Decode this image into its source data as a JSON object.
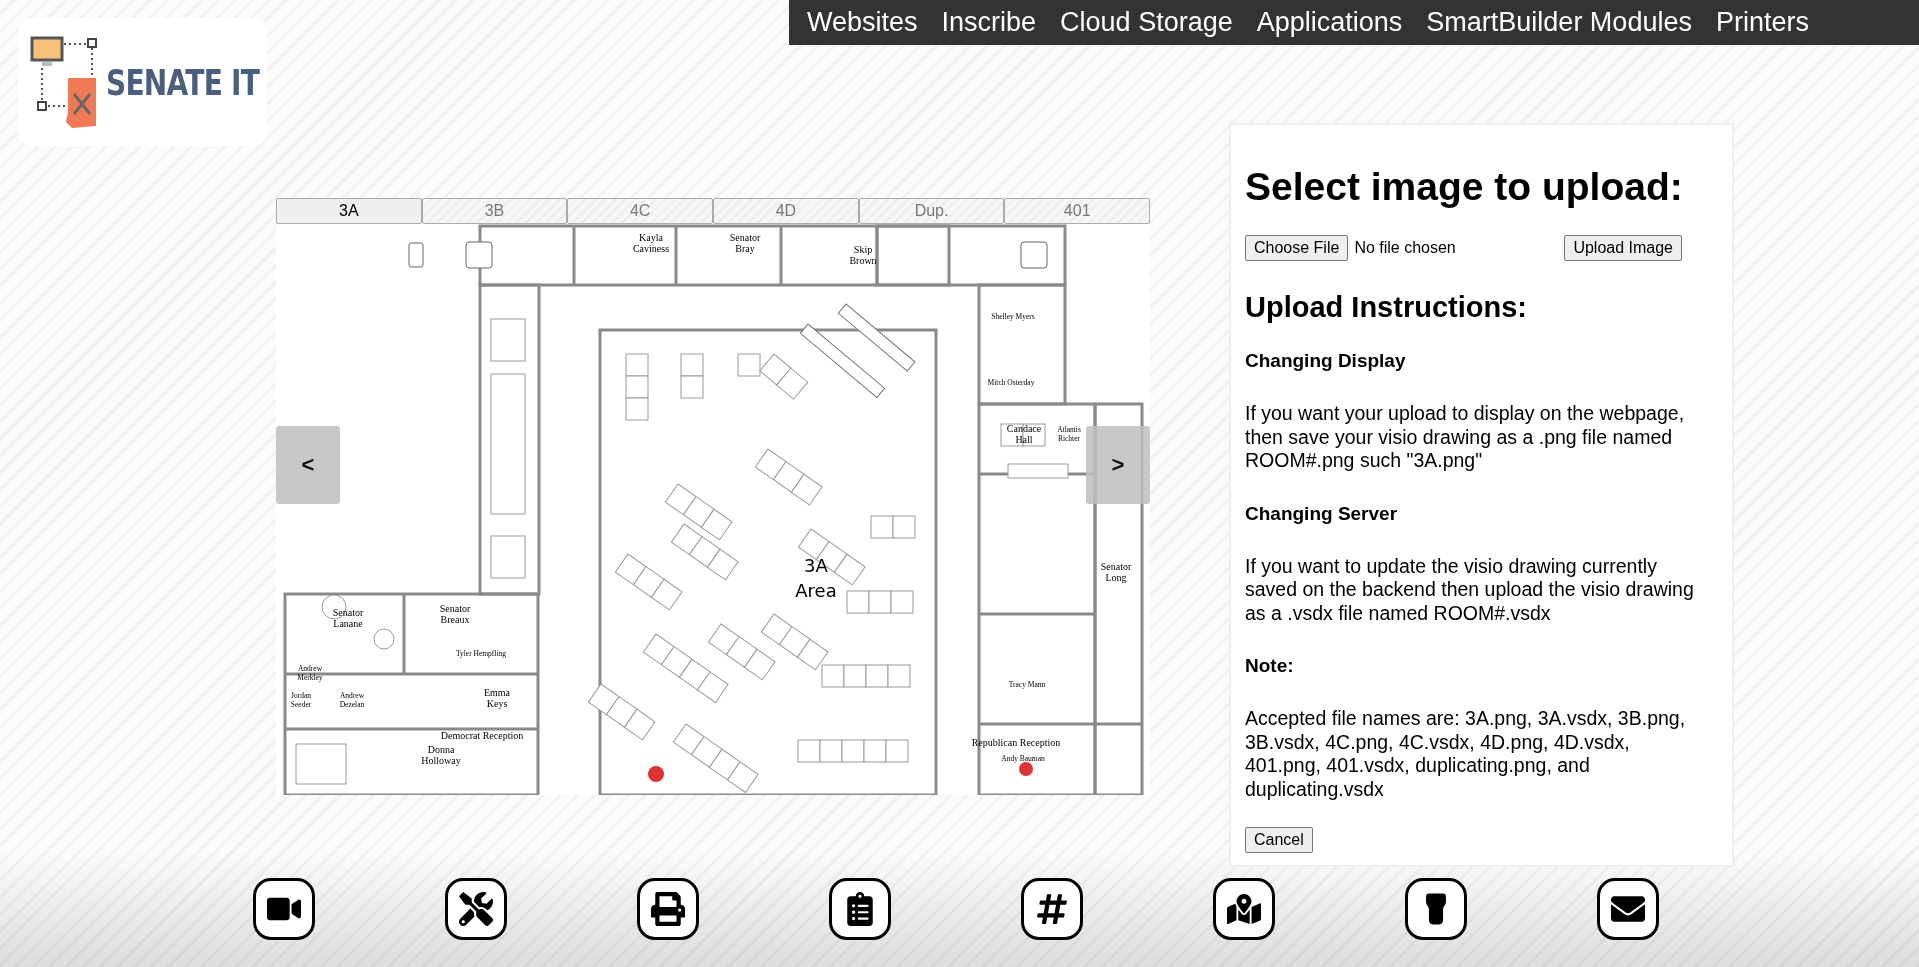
{
  "logo": {
    "text": "SENATE IT"
  },
  "nav": [
    {
      "label": "Websites"
    },
    {
      "label": "Inscribe"
    },
    {
      "label": "Cloud Storage"
    },
    {
      "label": "Applications"
    },
    {
      "label": "SmartBuilder Modules"
    },
    {
      "label": "Printers"
    }
  ],
  "floor_tabs": [
    {
      "label": "3A",
      "selected": true
    },
    {
      "label": "3B",
      "selected": false
    },
    {
      "label": "4C",
      "selected": false
    },
    {
      "label": "4D",
      "selected": false
    },
    {
      "label": "Dup.",
      "selected": false
    },
    {
      "label": "401",
      "selected": false
    }
  ],
  "floor_plan": {
    "prev": "<",
    "next": ">",
    "area_label": [
      "3A",
      "Area"
    ],
    "labels": [
      {
        "lines": [
          "Kayla",
          "Caviness"
        ]
      },
      {
        "lines": [
          "Senator",
          "Bray"
        ]
      },
      {
        "lines": [
          "Skip",
          "Brown"
        ]
      },
      {
        "lines": [
          "Shelley Myers"
        ]
      },
      {
        "lines": [
          "Mitch Osterday"
        ]
      },
      {
        "lines": [
          "Candace",
          "Hall"
        ]
      },
      {
        "lines": [
          "Atlantis",
          "Richter"
        ]
      },
      {
        "lines": [
          "Senator",
          "Long"
        ]
      },
      {
        "lines": [
          "Senator",
          "Lanane"
        ]
      },
      {
        "lines": [
          "Senator",
          "Breaux"
        ]
      },
      {
        "lines": [
          "Tyler Hempfling"
        ]
      },
      {
        "lines": [
          "Andrew",
          "Merkley"
        ]
      },
      {
        "lines": [
          "Jordan",
          "Seeder"
        ]
      },
      {
        "lines": [
          "Andrew",
          "Dezelan"
        ]
      },
      {
        "lines": [
          "Emma",
          "Keys"
        ]
      },
      {
        "lines": [
          "Democrat Reception"
        ]
      },
      {
        "lines": [
          "Donna",
          "Holloway"
        ]
      },
      {
        "lines": [
          "Tracy Mann"
        ]
      },
      {
        "lines": [
          "Republican Reception"
        ]
      },
      {
        "lines": [
          "Andy Bauman"
        ]
      }
    ]
  },
  "upload": {
    "title": "Select image to upload:",
    "choose_button": "Choose File",
    "file_status": "No file chosen",
    "upload_button": "Upload Image",
    "instructions_title": "Upload Instructions:",
    "sections": [
      {
        "heading": "Changing Display",
        "body": "If you want your upload to display on the webpage, then save your visio drawing as a .png file named ROOM#.png such \"3A.png\""
      },
      {
        "heading": "Changing Server",
        "body": "If you want to update the visio drawing currently saved on the backend then upload the visio drawing as a .vsdx file named ROOM#.vsdx"
      },
      {
        "heading": "Note:",
        "body": "Accepted file names are: 3A.png, 3A.vsdx, 3B.png, 3B.vsdx, 4C.png, 4C.vsdx, 4D.png, 4D.vsdx, 401.png, 401.vsdx, duplicating.png, and duplicating.vsdx"
      }
    ],
    "cancel_button": "Cancel"
  },
  "bottom_icons": [
    {
      "kind": "video"
    },
    {
      "kind": "tools"
    },
    {
      "kind": "printer"
    },
    {
      "kind": "inventory"
    },
    {
      "kind": "hashtag"
    },
    {
      "kind": "map"
    },
    {
      "kind": "flashlight"
    },
    {
      "kind": "mail"
    }
  ]
}
